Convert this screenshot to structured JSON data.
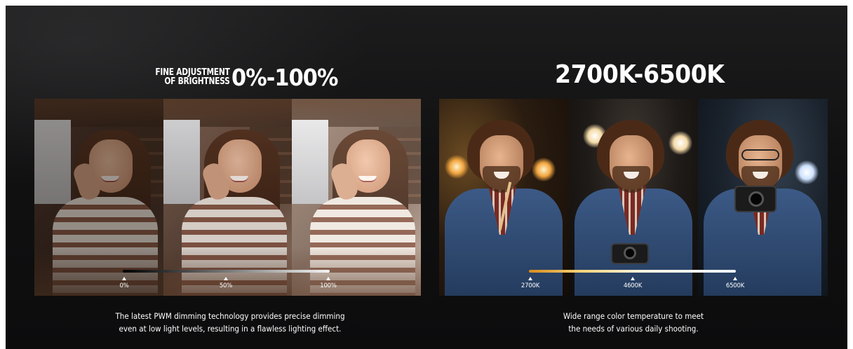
{
  "brightness": {
    "heading_small_line1": "FINE ADJUSTMENT",
    "heading_small_line2": "OF BRIGHTNESS",
    "heading_big": "0%-100%",
    "ticks": [
      "0%",
      "50%",
      "100%"
    ],
    "caption_line1": "The latest PWM dimming technology provides precise dimming",
    "caption_line2": "even at low light levels, resulting in a flawless lighting effect."
  },
  "color_temperature": {
    "heading": "2700K-6500K",
    "ticks": [
      "2700K",
      "4600K",
      "6500K"
    ],
    "caption_line1": "Wide range color temperature to meet",
    "caption_line2": "the needs of various daily shooting."
  },
  "colors": {
    "background": "#111112",
    "text": "#ffffff",
    "warm": "#d98a1c",
    "cool": "#eef4ff"
  }
}
